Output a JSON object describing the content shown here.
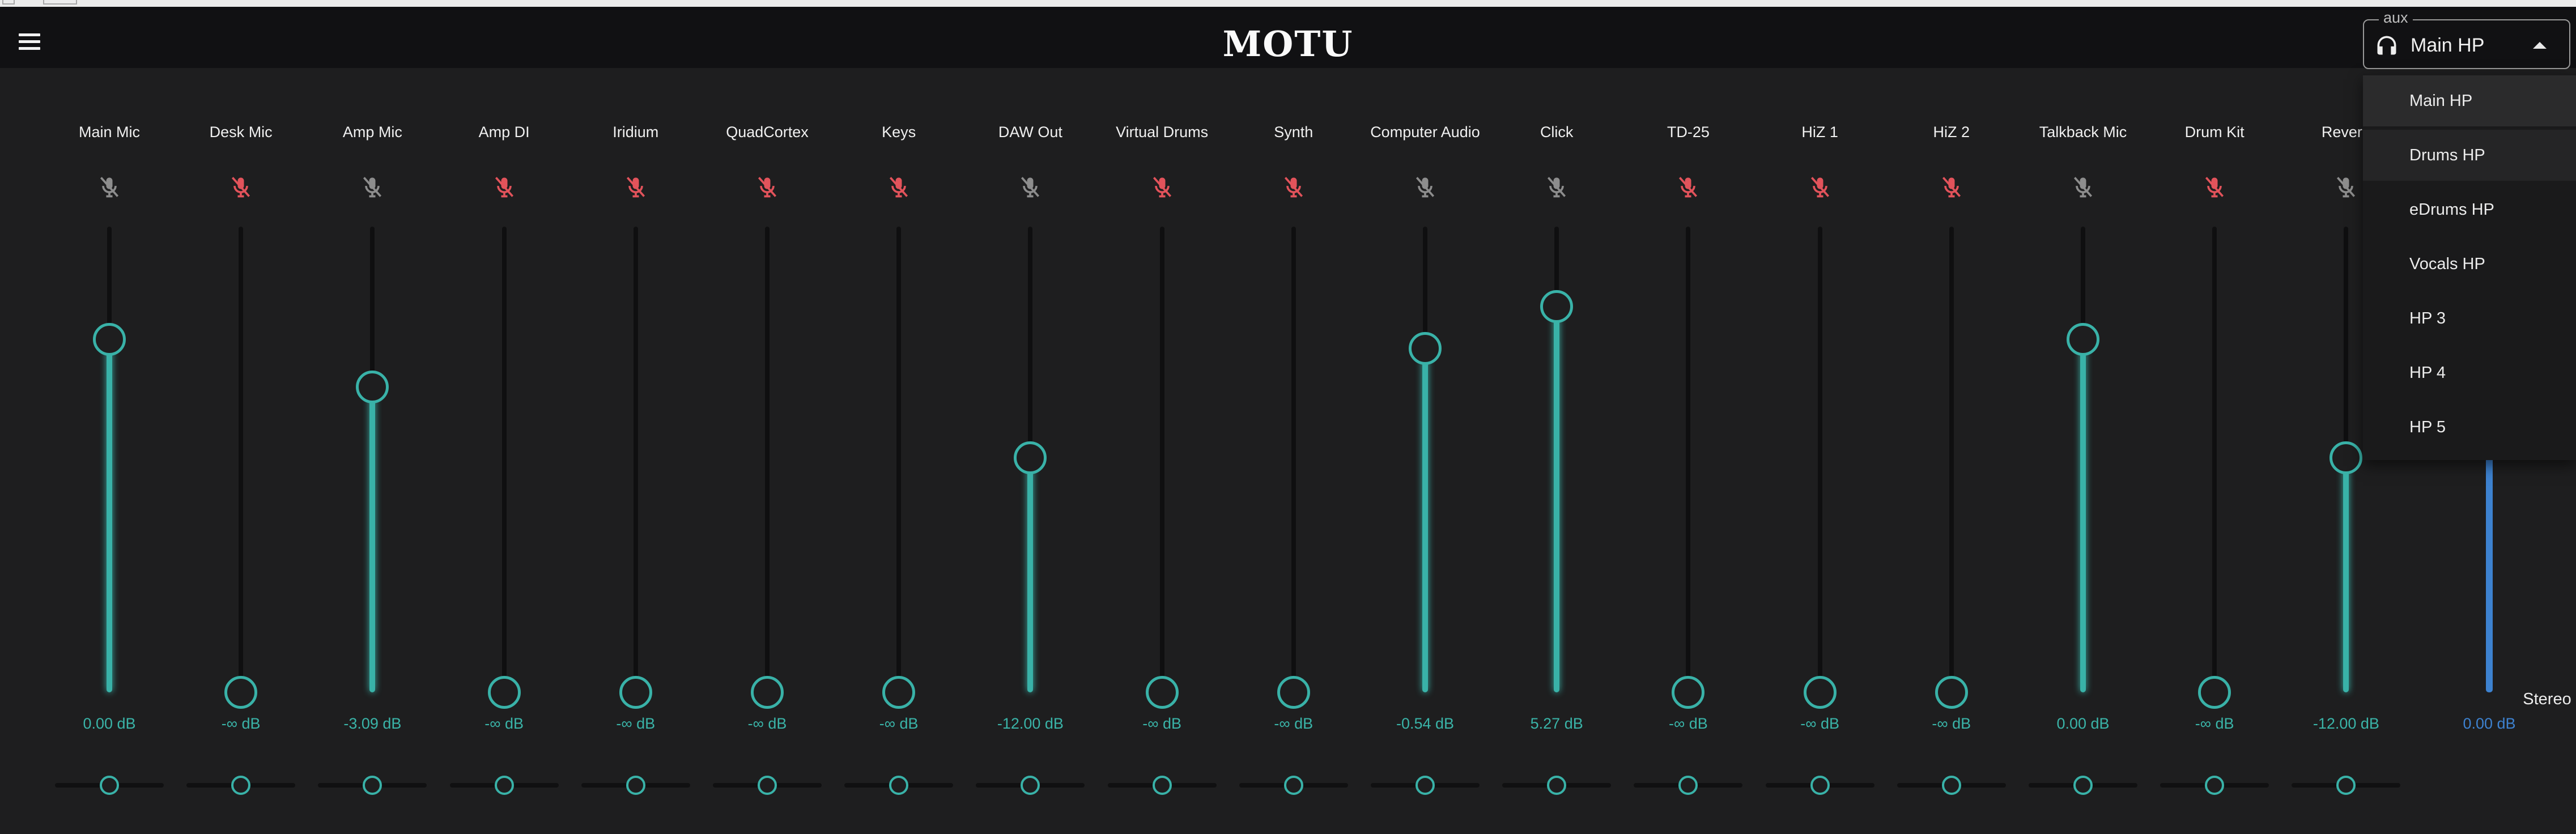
{
  "app": {
    "logo": "MOTU"
  },
  "aux": {
    "legend": "aux",
    "value": "Main HP"
  },
  "aux_options": [
    "Main HP",
    "Drums HP",
    "eDrums HP",
    "Vocals HP",
    "HP 3",
    "HP 4",
    "HP 5"
  ],
  "aux_selected_index": 0,
  "aux_hover_index": 1,
  "channels": [
    {
      "name": "Main Mic",
      "db": "0.00 dB",
      "muted": false,
      "level": 0.758
    },
    {
      "name": "Desk Mic",
      "db": "-∞ dB",
      "muted": true,
      "level": 0
    },
    {
      "name": "Amp Mic",
      "db": "-3.09 dB",
      "muted": false,
      "level": 0.656
    },
    {
      "name": "Amp DI",
      "db": "-∞ dB",
      "muted": true,
      "level": 0
    },
    {
      "name": "Iridium",
      "db": "-∞ dB",
      "muted": true,
      "level": 0
    },
    {
      "name": "QuadCortex",
      "db": "-∞ dB",
      "muted": true,
      "level": 0
    },
    {
      "name": "Keys",
      "db": "-∞ dB",
      "muted": true,
      "level": 0
    },
    {
      "name": "DAW Out",
      "db": "-12.00 dB",
      "muted": false,
      "level": 0.504
    },
    {
      "name": "Virtual Drums",
      "db": "-∞ dB",
      "muted": true,
      "level": 0
    },
    {
      "name": "Synth",
      "db": "-∞ dB",
      "muted": true,
      "level": 0
    },
    {
      "name": "Computer Audio",
      "db": "-0.54 dB",
      "muted": false,
      "level": 0.739
    },
    {
      "name": "Click",
      "db": "5.27 dB",
      "muted": false,
      "level": 0.828
    },
    {
      "name": "TD-25",
      "db": "-∞ dB",
      "muted": true,
      "level": 0
    },
    {
      "name": "HiZ 1",
      "db": "-∞ dB",
      "muted": true,
      "level": 0
    },
    {
      "name": "HiZ 2",
      "db": "-∞ dB",
      "muted": true,
      "level": 0
    },
    {
      "name": "Talkback Mic",
      "db": "0.00 dB",
      "muted": false,
      "level": 0.758
    },
    {
      "name": "Drum Kit",
      "db": "-∞ dB",
      "muted": true,
      "level": 0
    },
    {
      "name": "Reverb",
      "db": "-12.00 dB",
      "muted": false,
      "level": 0.504
    }
  ],
  "master": {
    "label": "Stereo",
    "db": "0.00 dB",
    "level": 0.758
  },
  "colors": {
    "accent": "#39b2a8",
    "muted": "#e2535b",
    "unmuted": "#8d8d8d",
    "master": "#3d82d0",
    "background": "#1e1e1f",
    "appbar": "#111113"
  },
  "icons": {
    "menu": "hamburger-icon",
    "aux": "headphones-icon",
    "mute": "mic-off-icon",
    "caret": "caret-up-icon"
  }
}
